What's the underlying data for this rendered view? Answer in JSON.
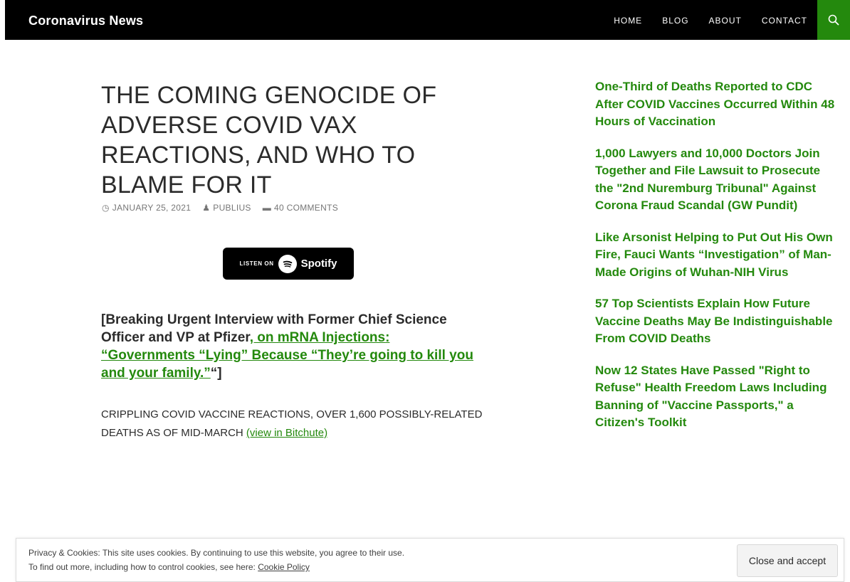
{
  "header": {
    "site_title": "Coronavirus News",
    "nav": [
      "HOME",
      "BLOG",
      "ABOUT",
      "CONTACT"
    ],
    "search_icon": "search-icon"
  },
  "post": {
    "title": "THE COMING GENOCIDE OF ADVERSE COVID VAX REACTIONS, AND WHO TO BLAME FOR IT",
    "date": "JANUARY 25, 2021",
    "author": "PUBLIUS",
    "comments": "40 COMMENTS",
    "spotify_listen": "LISTEN ON",
    "spotify_brand": "Spotify",
    "interview_prefix": "[Breaking Urgent Interview with Former Chief Science Officer and VP at Pfizer",
    "interview_mid": ", on mRNA Injections",
    "interview_link": ": “Governments “Lying” Because “They’re going to kill you and your family.”",
    "interview_suffix": "“]",
    "crippling_text": "CRIPPLING COVID VACCINE REACTIONS, OVER 1,600 POSSIBLY-RELATED DEATHS AS OF MID-MARCH",
    "crippling_link": "(view in Bitchute)"
  },
  "sidebar": {
    "links": [
      "One-Third of Deaths Reported to CDC After COVID Vaccines Occurred Within 48 Hours of Vaccination",
      "1,000 Lawyers and 10,000 Doctors Join Together and File Lawsuit to Prosecute the \"2nd Nuremburg Tribunal\" Against Corona Fraud Scandal (GW Pundit)",
      "Like Arsonist Helping to Put Out His Own Fire, Fauci Wants “Investigation” of Man-Made Origins of Wuhan-NIH Virus",
      "57 Top Scientists Explain How Future Vaccine Deaths May Be Indistinguishable From COVID Deaths",
      "Now 12 States Have Passed \"Right to Refuse\" Health Freedom Laws Including Banning of \"Vaccine Passports,\" a Citizen's Toolkit"
    ]
  },
  "cookie": {
    "line1": "Privacy & Cookies: This site uses cookies. By continuing to use this website, you agree to their use.",
    "line2": "To find out more, including how to control cookies, see here: ",
    "policy_link": "Cookie Policy",
    "button": "Close and accept"
  },
  "colors": {
    "accent": "#24890d",
    "header_bg": "#000000"
  }
}
